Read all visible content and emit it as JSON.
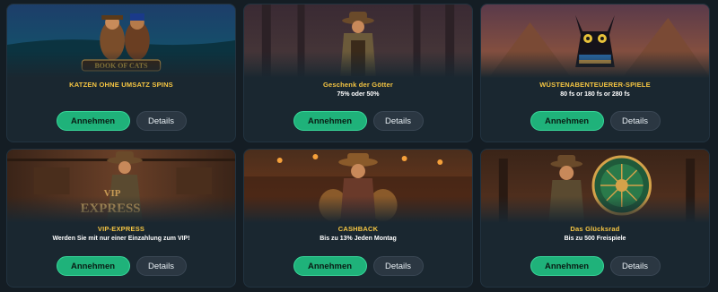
{
  "buttons": {
    "accept": "Annehmen",
    "details": "Details"
  },
  "logo_text": {
    "book_of_cats": "BOOK OF CATS",
    "vip_line1": "VIP",
    "vip_line2": "EXPRESS"
  },
  "cards": [
    {
      "title": "KATZEN OHNE UMSATZ SPINS",
      "subtitle": ""
    },
    {
      "title": "Geschenk der Götter",
      "subtitle": "75% oder 50%"
    },
    {
      "title": "WÜSTENABENTEUERER-SPIELE",
      "subtitle": "80 fs or 180 fs or 280 fs"
    },
    {
      "title": "VIP-EXPRESS",
      "subtitle": "Werden Sie mit nur einer Einzahlung zum VIP!"
    },
    {
      "title": "CASHBACK",
      "subtitle": "Bis zu 13% Jeden Montag"
    },
    {
      "title": "Das Glücksrad",
      "subtitle": "Bis zu 500 Freispiele"
    }
  ],
  "colors": {
    "background": "#141d24",
    "card": "#1a2730",
    "title": "#f5c542",
    "accept": "#1fb27a"
  }
}
